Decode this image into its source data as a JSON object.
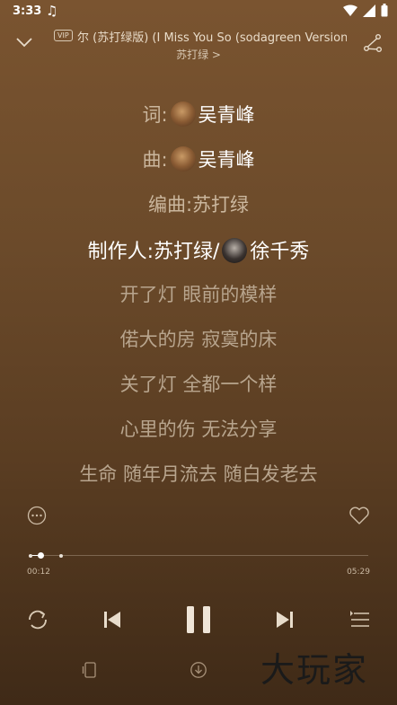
{
  "status_bar": {
    "time": "3:33"
  },
  "header": {
    "vip_badge": "VIP",
    "song_title": "尔 (苏打绿版) (I Miss You So (sodagreen Version)",
    "artist": "苏打绿 >"
  },
  "credits": {
    "lyricist_label": "词:",
    "lyricist": "吴青峰",
    "composer_label": "曲:",
    "composer": "吴青峰",
    "arranger": "编曲:苏打绿",
    "producer_label": "制作人:苏打绿/",
    "producer": "徐千秀"
  },
  "lyrics": [
    "开了灯 眼前的模样",
    "偌大的房 寂寞的床",
    "关了灯 全都一个样",
    "心里的伤 无法分享",
    "生命 随年月流去 随白发老去"
  ],
  "progress": {
    "current_time": "00:12",
    "total_time": "05:29",
    "fraction": 0.036
  },
  "watermark": "大玩家",
  "icons": {
    "status": [
      "music-note-icon",
      "wifi-icon",
      "signal-icon",
      "battery-icon"
    ],
    "header": [
      "chevron-down-icon",
      "share-icon"
    ],
    "controls": [
      "repeat-icon",
      "previous-icon",
      "pause-icon",
      "next-icon",
      "playlist-icon"
    ],
    "bottom": [
      "device-icon",
      "download-icon"
    ]
  }
}
